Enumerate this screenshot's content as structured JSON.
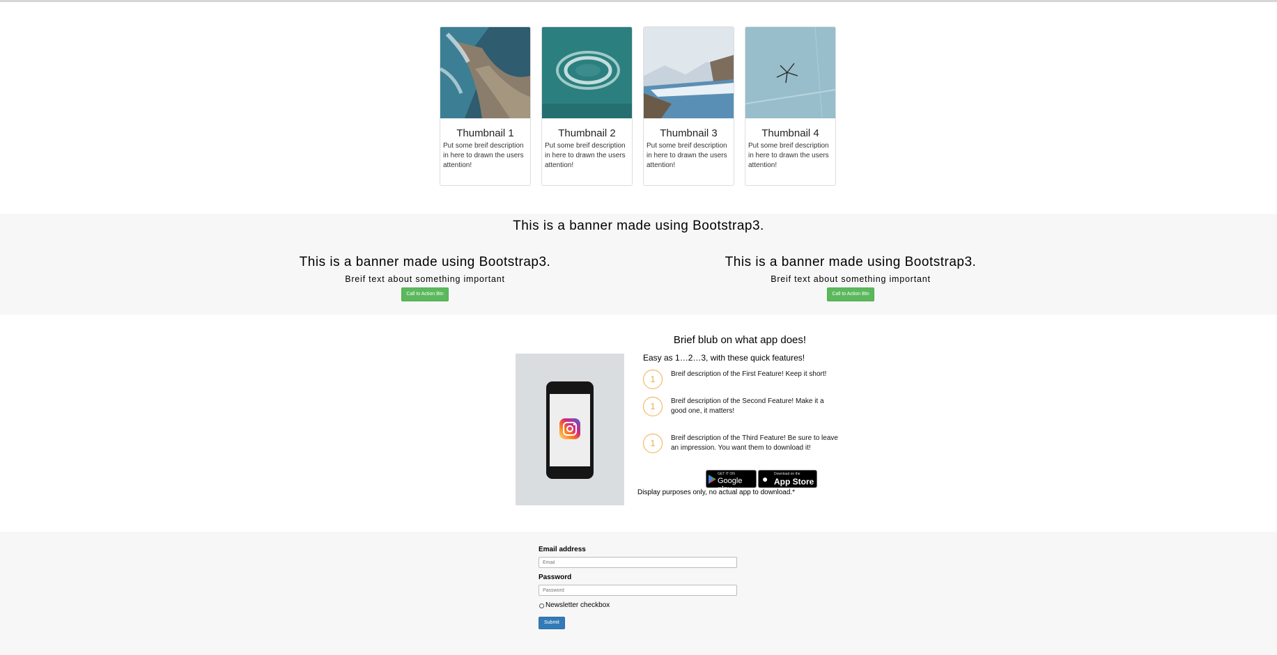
{
  "thumbnails": [
    {
      "title": "Thumbnail 1",
      "description": "Put some breif description in here to drawn the users attention!"
    },
    {
      "title": "Thumbnail 2",
      "description": "Put some breif description in here to drawn the users attention!"
    },
    {
      "title": "Thumbnail 3",
      "description": "Put some breif description in here to drawn the users attention!"
    },
    {
      "title": "Thumbnail 4",
      "description": "Put some breif description in here to drawn the users attention!"
    }
  ],
  "banner": {
    "title": "This is a banner made using Bootstrap3.",
    "columns": [
      {
        "title": "This is a banner made using Bootstrap3.",
        "text": "Breif text about something important",
        "button": "Call to Action Btn"
      },
      {
        "title": "This is a banner made using Bootstrap3.",
        "text": "Breif text about something important",
        "button": "Call to Action Btn"
      }
    ]
  },
  "app": {
    "heading": "Brief blub on what app does!",
    "subheading": "Easy as 1…2…3, with these quick features!",
    "features": [
      {
        "number": "1",
        "text": "Breif description of the First Feature! Keep it short!"
      },
      {
        "number": "1",
        "text": "Breif description of the Second Feature! Make it a good one, it matters!"
      },
      {
        "number": "1",
        "text": "Breif description of the Third Feature! Be sure to leave an impression. You want them to download it!"
      }
    ],
    "google_play": {
      "small": "GET IT ON",
      "big": "Google play"
    },
    "app_store": {
      "small": "Download on the",
      "big": "App Store"
    },
    "disclaimer": "Display purposes only, no actual app to download.*"
  },
  "form": {
    "email_label": "Email address",
    "email_placeholder": "Email",
    "password_label": "Password",
    "password_placeholder": "Password",
    "newsletter_label": "Newsletter checkbox",
    "submit_label": "Submit"
  },
  "colors": {
    "cta_green": "#5cb85c",
    "submit_blue": "#337ab7",
    "feature_orange": "#f0ad4e",
    "section_gray": "#f7f7f7"
  }
}
